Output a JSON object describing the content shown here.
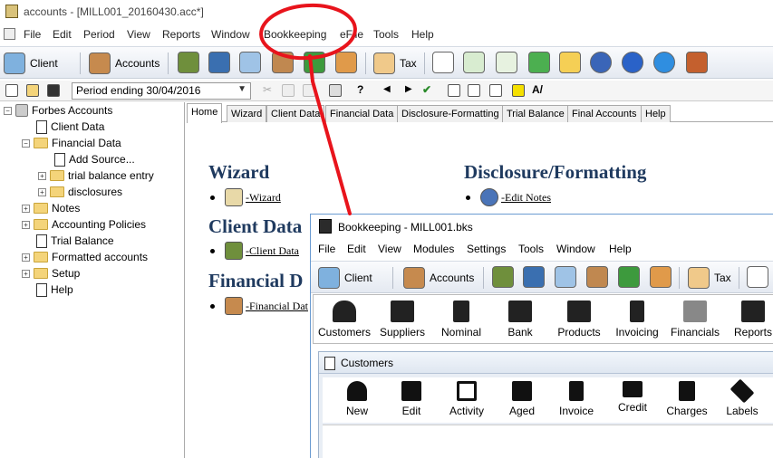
{
  "window": {
    "title": "accounts - [MILL001_20160430.acc*]"
  },
  "menu": [
    "File",
    "Edit",
    "Period",
    "View",
    "Reports",
    "Window",
    "Bookkeeping",
    "eFile",
    "Tools",
    "Help"
  ],
  "main_toolbar": {
    "client_label": "Client",
    "accounts_label": "Accounts",
    "tax_label": "Tax"
  },
  "toolbar2": {
    "period_value": "Period ending 30/04/2016"
  },
  "tree": {
    "root": "Forbes Accounts",
    "client_data": "Client Data",
    "financial_data": "Financial Data",
    "add_source": "Add Source...",
    "trial_balance_entry": "trial balance entry",
    "disclosures": "disclosures",
    "notes": "Notes",
    "accounting_policies": "Accounting Policies",
    "trial_balance": "Trial Balance",
    "formatted_accounts": "Formatted accounts",
    "setup": "Setup",
    "help": "Help"
  },
  "tabs": [
    "Home",
    "Wizard",
    "Client Data",
    "Financial Data",
    "Disclosure-Formatting",
    "Trial Balance",
    "Final Accounts",
    "Help"
  ],
  "home": {
    "wizard_heading": "Wizard",
    "wizard_link": "-Wizard",
    "client_heading": "Client Data",
    "client_link": "-Client Data",
    "financial_heading": "Financial D",
    "financial_link": "-Financial Dat",
    "disclosure_heading": "Disclosure/Formatting",
    "edit_notes_link": "-Edit Notes"
  },
  "bookkeeping": {
    "title": "Bookkeeping - MILL001.bks",
    "menu": [
      "File",
      "Edit",
      "View",
      "Modules",
      "Settings",
      "Tools",
      "Window",
      "Help"
    ],
    "toolbar": {
      "client_label": "Client",
      "accounts_label": "Accounts",
      "tax_label": "Tax"
    },
    "modules": [
      "Customers",
      "Suppliers",
      "Nominal",
      "Bank",
      "Products",
      "Invoicing",
      "Financials",
      "Reports"
    ],
    "customers": {
      "title": "Customers",
      "tools": [
        "New",
        "Edit",
        "Activity",
        "Aged",
        "Invoice",
        "Credit",
        "Charges",
        "Labels"
      ]
    }
  },
  "colors": {
    "annotation": "#e8141c",
    "heading": "#1f3a5f",
    "toolbar_top": "#fafbfd",
    "toolbar_bottom": "#e4e9f1"
  }
}
